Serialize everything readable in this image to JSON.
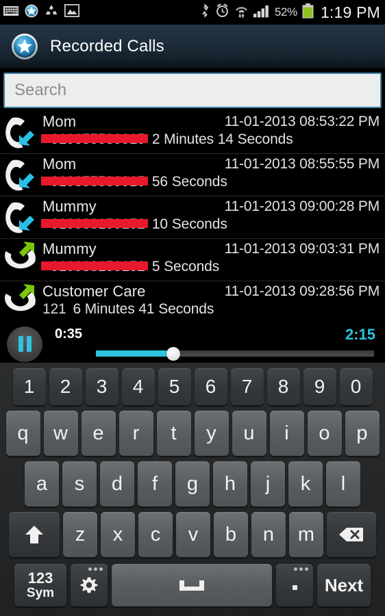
{
  "status_bar": {
    "left_icons": [
      "keyboard-icon",
      "app-star-icon",
      "recycle-icon",
      "image-icon"
    ],
    "right_icons": [
      "bluetooth-icon",
      "alarm-icon",
      "wifi-icon",
      "signal-icon"
    ],
    "battery_percent": "52%",
    "clock": "1:19 PM"
  },
  "title_bar": {
    "icon": "app-star-icon",
    "title": "Recorded Calls"
  },
  "search": {
    "placeholder": "Search",
    "value": ""
  },
  "calls": [
    {
      "name": "Mom",
      "number": "+919855589915",
      "number_redacted": true,
      "datetime": "11-01-2013 08:53:22 PM",
      "duration": "2 Minutes 14 Seconds",
      "direction": "incoming",
      "icon": "incoming-call-icon"
    },
    {
      "name": "Mom",
      "number": "+919855589915",
      "number_redacted": true,
      "datetime": "11-01-2013 08:55:55 PM",
      "duration": "56 Seconds",
      "direction": "incoming",
      "icon": "incoming-call-icon"
    },
    {
      "name": "Mummy",
      "number": "+919988159152",
      "number_redacted": true,
      "datetime": "11-01-2013 09:00:28 PM",
      "duration": "10 Seconds",
      "direction": "incoming",
      "icon": "incoming-call-icon"
    },
    {
      "name": "Mummy",
      "number": "+919988159152",
      "number_redacted": true,
      "datetime": "11-01-2013 09:03:31 PM",
      "duration": "5 Seconds",
      "direction": "outgoing",
      "icon": "outgoing-call-icon"
    },
    {
      "name": "Customer Care",
      "number": "121",
      "number_redacted": false,
      "datetime": "11-01-2013 09:28:56 PM",
      "duration": "6 Minutes 41 Seconds",
      "direction": "outgoing",
      "icon": "outgoing-call-icon"
    }
  ],
  "player": {
    "button_icon": "pause-icon",
    "current_time": "0:35",
    "total_time": "2:15",
    "progress_percent": 26,
    "accent_color": "#2ec4de"
  },
  "keyboard": {
    "row_numbers": [
      "1",
      "2",
      "3",
      "4",
      "5",
      "6",
      "7",
      "8",
      "9",
      "0"
    ],
    "row_top": [
      "q",
      "w",
      "e",
      "r",
      "t",
      "y",
      "u",
      "i",
      "o",
      "p"
    ],
    "row_home": [
      "a",
      "s",
      "d",
      "f",
      "g",
      "h",
      "j",
      "k",
      "l"
    ],
    "row_bottom": [
      "z",
      "x",
      "c",
      "v",
      "b",
      "n",
      "m"
    ],
    "shift_icon": "shift-arrow-icon",
    "backspace_icon": "backspace-icon",
    "sym_line1": "123",
    "sym_line2": "Sym",
    "settings_icon": "gear-icon",
    "space_icon": "space-bar-icon",
    "period_label": ".",
    "next_label": "Next"
  },
  "colors": {
    "accent": "#2ec4de",
    "redaction": "#e8192c",
    "incoming_arrow": "#29c0e8",
    "outgoing_arrow": "#7ac70c",
    "battery": "#8ec21f",
    "title_bar": "#1d2c3a"
  }
}
